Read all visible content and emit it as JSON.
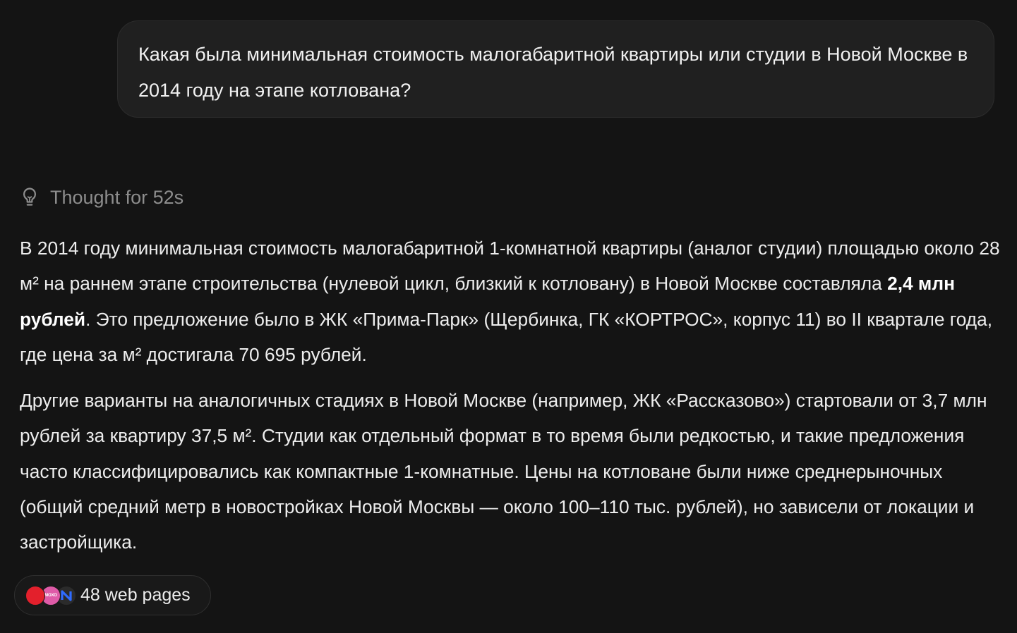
{
  "user_message": {
    "text": "Какая была минимальная стоимость малогабаритной квартиры или студии в Новой Москве в 2014 году на этапе котлована?"
  },
  "thought": {
    "label": "Thought for 52s",
    "icon": "lightbulb-icon"
  },
  "answer": {
    "p1_before_bold": "В 2014 году минимальная стоимость малогабаритной 1-комнатной квартиры (аналог студии) площадью около 28 м² на раннем этапе строительства (нулевой цикл, близкий к котловану) в Новой Москве составляла ",
    "p1_bold": "2,4 млн рублей",
    "p1_after_bold": ". Это предложение было в ЖК «Прима-Парк» (Щербинка, ГК «КОРТРОС», корпус 11) во II квартале года, где цена за м² достигала 70 695 рублей.",
    "p2": "Другие варианты на аналогичных стадиях в Новой Москве (например, ЖК «Рассказово») стартовали от 3,7 млн рублей за квартиру 37,5 м². Студии как отдельный формат в то время были редкостью, и такие предложения часто классифицировались как компактные 1-комнатные. Цены на котловане были ниже среднерыночных (общий средний метр в новостройках Новой Москвы — около 100–110 тыс. рублей), но зависели от локации и застройщика."
  },
  "sources": {
    "label": "48 web pages",
    "favicons": [
      {
        "name": "red-circle-favicon",
        "color": "#e3202c"
      },
      {
        "name": "pink-favicon",
        "color": "#df5ba8",
        "text": "MOXO"
      },
      {
        "name": "blue-n-favicon",
        "color": "#2f6bff"
      }
    ]
  },
  "colors": {
    "background": "#141414",
    "bubble": "#202020",
    "text": "#ececec",
    "muted": "#8d8d8d"
  }
}
